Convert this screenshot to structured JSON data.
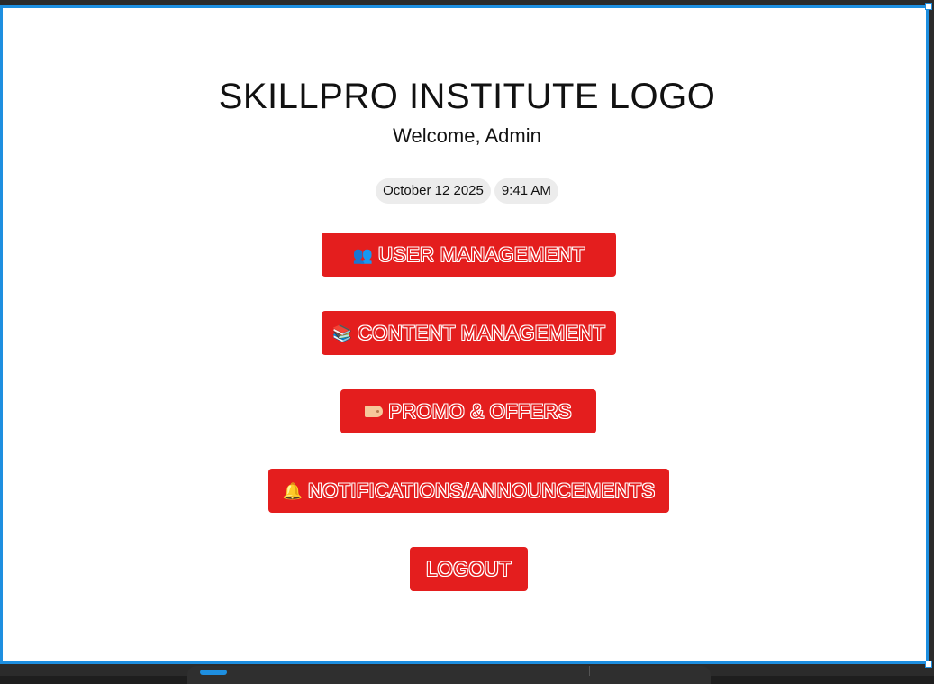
{
  "header": {
    "logo_text": "SKILLPRO INSTITUTE LOGO",
    "welcome_text": "Welcome, Admin"
  },
  "status": {
    "date": "October 12 2025",
    "time": "9:41 AM"
  },
  "menu": {
    "items": [
      {
        "label": "USER MANAGEMENT",
        "icon": "users-icon"
      },
      {
        "label": "CONTENT MANAGEMENT",
        "icon": "books-icon"
      },
      {
        "label": "PROMO & OFFERS",
        "icon": "tag-icon"
      },
      {
        "label": "NOTIFICATIONS/ANNOUNCEMENTS",
        "icon": "bell-icon"
      },
      {
        "label": "LOGOUT",
        "icon": ""
      }
    ]
  },
  "colors": {
    "accent": "#e41e1e",
    "selection_border": "#1e8fe0",
    "pill_bg": "#ececec"
  }
}
